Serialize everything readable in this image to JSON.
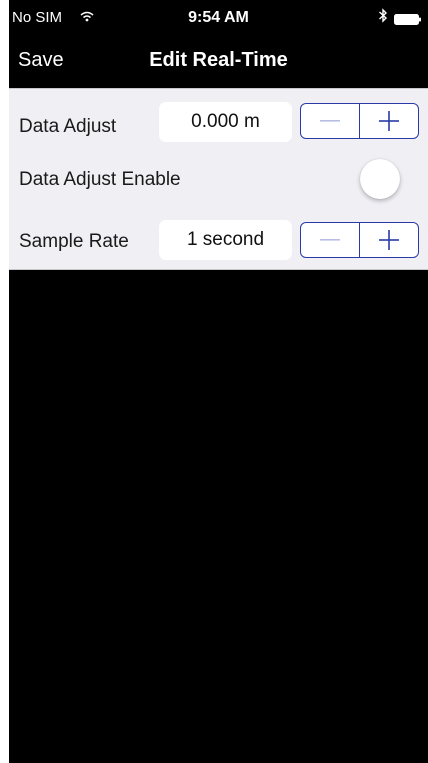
{
  "status_bar": {
    "carrier": "No SIM",
    "time": "9:54 AM"
  },
  "nav": {
    "save_label": "Save",
    "title": "Edit Real-Time"
  },
  "settings": {
    "data_adjust": {
      "label": "Data Adjust",
      "value": "0.000 m",
      "minus_enabled": false
    },
    "data_adjust_enable": {
      "label": "Data Adjust Enable",
      "on": false
    },
    "sample_rate": {
      "label": "Sample Rate",
      "value": "1 second",
      "minus_enabled": false
    }
  },
  "colors": {
    "accent": "#2a3aa8",
    "disabled_accent": "#b8bde6",
    "panel_bg": "#efeff4",
    "bar_bg": "#000000"
  }
}
